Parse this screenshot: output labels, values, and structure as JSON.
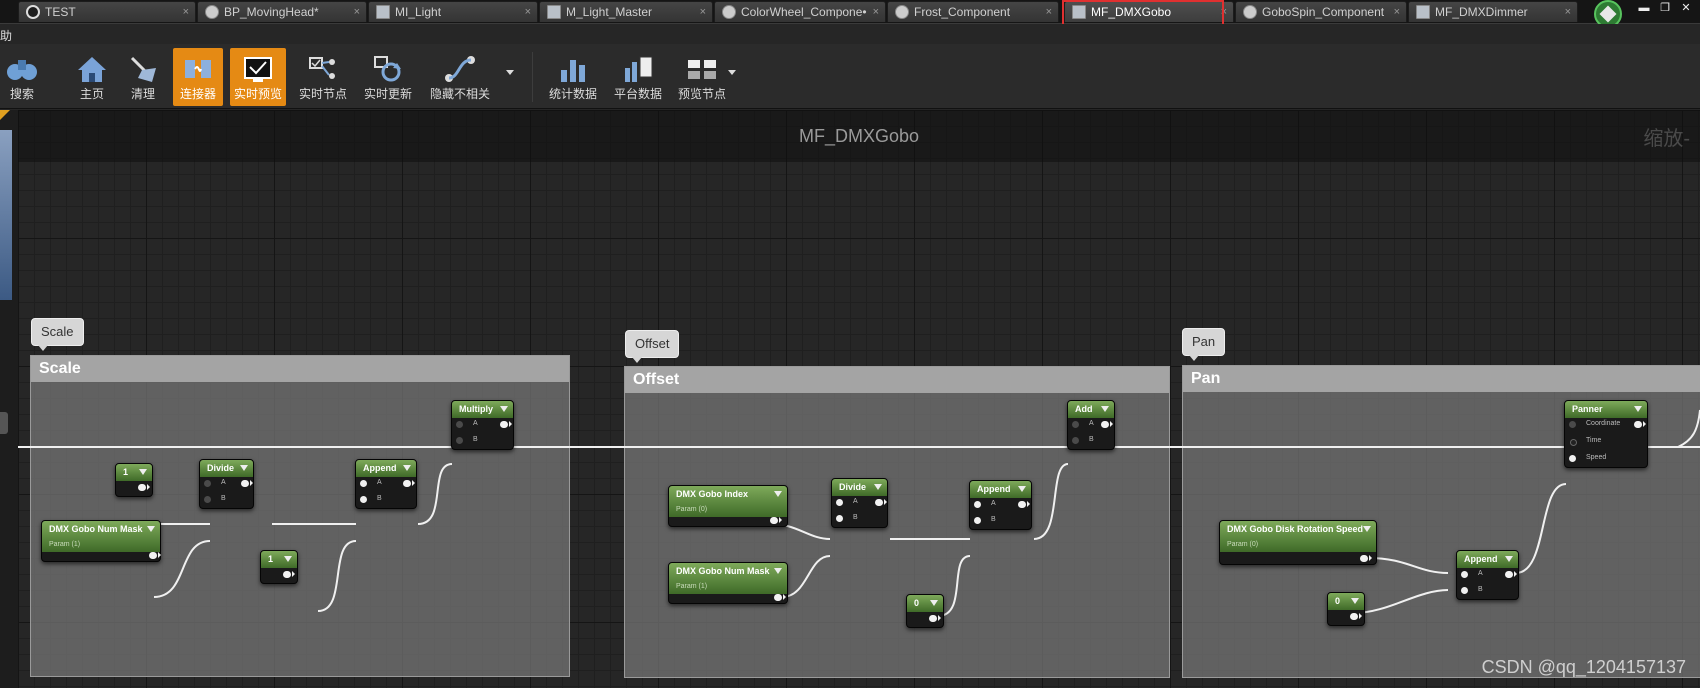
{
  "tabs": [
    {
      "label": "TEST",
      "icon": "level-icon"
    },
    {
      "label": "BP_MovingHead*",
      "icon": "blueprint-icon"
    },
    {
      "label": "MI_Light",
      "icon": "material-instance-icon"
    },
    {
      "label": "M_Light_Master",
      "icon": "material-icon"
    },
    {
      "label": "ColorWheel_Compone•",
      "icon": "component-icon"
    },
    {
      "label": "Frost_Component",
      "icon": "component-icon"
    },
    {
      "label": "MF_DMXGobo",
      "icon": "material-function-icon",
      "active": true
    },
    {
      "label": "GoboSpin_Component",
      "icon": "component-icon"
    },
    {
      "label": "MF_DMXDimmer",
      "icon": "material-function-icon"
    }
  ],
  "menu": {
    "help_fragment": "助"
  },
  "toolbar": {
    "search": "搜索",
    "home": "主页",
    "clean": "清理",
    "connectors": "连接器",
    "live_preview": "实时预览",
    "live_nodes": "实时节点",
    "live_update": "实时更新",
    "hide_unrelated": "隐藏不相关",
    "stats": "统计数据",
    "platform_stats": "平台数据",
    "preview_node": "预览节点"
  },
  "graph": {
    "title": "MF_DMXGobo",
    "zoom_label": "缩放-",
    "watermark": "CSDN @qq_1204157137"
  },
  "comments": {
    "scale": {
      "bubble": "Scale",
      "header": "Scale"
    },
    "offset": {
      "bubble": "Offset",
      "header": "Offset"
    },
    "pan": {
      "bubble": "Pan",
      "header": "Pan"
    }
  },
  "nodes": {
    "scale_const1": "1",
    "scale_const2": "1",
    "scale_num_mask": {
      "title": "DMX Gobo Num Mask",
      "sub": "Param (1)"
    },
    "scale_divide": "Divide",
    "scale_append": "Append",
    "scale_multiply": "Multiply",
    "offset_index": {
      "title": "DMX Gobo Index",
      "sub": "Param (0)"
    },
    "offset_num_mask": {
      "title": "DMX Gobo Num Mask",
      "sub": "Param (1)"
    },
    "offset_divide": "Divide",
    "offset_append": "Append",
    "offset_add": "Add",
    "offset_const0": "0",
    "pan_rot_speed": {
      "title": "DMX Gobo Disk Rotation Speed",
      "sub": "Param (0)"
    },
    "pan_const0": "0",
    "pan_append": "Append",
    "pan_panner": "Panner",
    "pins": {
      "a": "A",
      "b": "B",
      "coordinate": "Coordinate",
      "time": "Time",
      "speed": "Speed"
    }
  }
}
